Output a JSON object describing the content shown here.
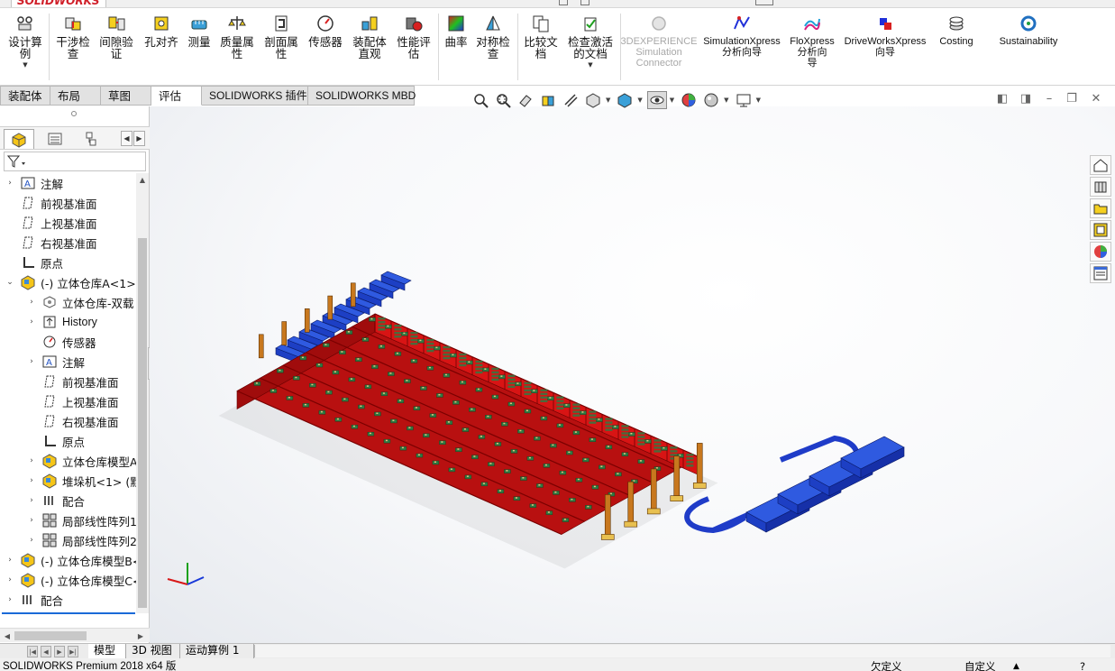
{
  "app": {
    "logo": "SOLIDWORKS"
  },
  "ribbon": {
    "buttons": [
      {
        "label": "设计算\n例",
        "icon": "design-study-icon",
        "disabled": false
      },
      {
        "label": "干涉检\n查",
        "icon": "interference-detection-icon",
        "disabled": false
      },
      {
        "label": "间隙验\n证",
        "icon": "clearance-verification-icon",
        "disabled": false
      },
      {
        "label": "孔对齐",
        "icon": "hole-alignment-icon",
        "disabled": false
      },
      {
        "label": "测量",
        "icon": "measure-icon",
        "disabled": false
      },
      {
        "label": "质量属\n性",
        "icon": "mass-properties-icon",
        "disabled": false
      },
      {
        "label": "剖面属\n性",
        "icon": "section-properties-icon",
        "disabled": false
      },
      {
        "label": "传感器",
        "icon": "sensor-icon",
        "disabled": false
      },
      {
        "label": "装配体\n直观",
        "icon": "assembly-visualization-icon",
        "disabled": false
      },
      {
        "label": "性能评\n估",
        "icon": "performance-evaluation-icon",
        "disabled": false
      },
      {
        "label": "曲率",
        "icon": "curvature-icon",
        "disabled": false
      },
      {
        "label": "对称检\n查",
        "icon": "symmetry-check-icon",
        "disabled": false
      },
      {
        "label": "比较文\n档",
        "icon": "compare-documents-icon",
        "disabled": false
      },
      {
        "label": "检查激活\n的文档",
        "icon": "check-active-document-icon",
        "disabled": false
      },
      {
        "label": "3DEXPERIENCE\nSimulation\nConnector",
        "icon": "3dexperience-icon",
        "disabled": true
      },
      {
        "label": "SimulationXpress\n分析向导",
        "icon": "simulationxpress-icon",
        "disabled": false
      },
      {
        "label": "FloXpress\n分析向\n导",
        "icon": "floxpress-icon",
        "disabled": false
      },
      {
        "label": "DriveWorksXpress\n向导",
        "icon": "driveworksxpress-icon",
        "disabled": false
      },
      {
        "label": "Costing",
        "icon": "costing-icon",
        "disabled": false
      },
      {
        "label": "Sustainability",
        "icon": "sustainability-icon",
        "disabled": false
      }
    ]
  },
  "tabs": [
    "装配体",
    "布局",
    "草图",
    "评估",
    "SOLIDWORKS 插件",
    "SOLIDWORKS MBD"
  ],
  "active_tab": "评估",
  "tree": [
    {
      "label": "注解",
      "icon": "annotation-icon",
      "expander": "›"
    },
    {
      "label": "前视基准面",
      "icon": "plane-icon",
      "expander": ""
    },
    {
      "label": "上视基准面",
      "icon": "plane-icon",
      "expander": ""
    },
    {
      "label": "右视基准面",
      "icon": "plane-icon",
      "expander": ""
    },
    {
      "label": "原点",
      "icon": "origin-icon",
      "expander": ""
    },
    {
      "label": "(-) 立体仓库A<1>",
      "icon": "assembly-icon",
      "expander": "⌄"
    },
    {
      "label": "立体仓库-双载",
      "icon": "part-icon",
      "expander": "›"
    },
    {
      "label": "History",
      "icon": "history-icon",
      "expander": "›"
    },
    {
      "label": "传感器",
      "icon": "sensor-icon",
      "expander": ""
    },
    {
      "label": "注解",
      "icon": "annotation-icon",
      "expander": "›"
    },
    {
      "label": "前视基准面",
      "icon": "plane-icon",
      "expander": ""
    },
    {
      "label": "上视基准面",
      "icon": "plane-icon",
      "expander": ""
    },
    {
      "label": "右视基准面",
      "icon": "plane-icon",
      "expander": ""
    },
    {
      "label": "原点",
      "icon": "origin-icon",
      "expander": ""
    },
    {
      "label": "立体仓库模型A",
      "icon": "assembly-icon",
      "expander": "›"
    },
    {
      "label": "堆垛机<1> (默",
      "icon": "assembly-icon",
      "expander": "›"
    },
    {
      "label": "配合",
      "icon": "mates-icon",
      "expander": "›"
    },
    {
      "label": "局部线性阵列1",
      "icon": "pattern-icon",
      "expander": "›"
    },
    {
      "label": "局部线性阵列2",
      "icon": "pattern-icon",
      "expander": "›"
    },
    {
      "label": "(-) 立体仓库模型B<",
      "icon": "assembly-icon",
      "expander": "›"
    },
    {
      "label": "(-) 立体仓库模型C<",
      "icon": "assembly-icon",
      "expander": "›"
    },
    {
      "label": "配合",
      "icon": "mates-icon",
      "expander": "›"
    }
  ],
  "bottom_tabs": [
    "模型",
    "3D 视图",
    "运动算例 1"
  ],
  "active_bottom_tab": "模型",
  "status": {
    "product": "SOLIDWORKS Premium 2018 x64 版",
    "state": "欠定义",
    "custom": "自定义"
  },
  "colors": {
    "rack_red": "#d81414",
    "goods_green": "#2f7a43",
    "conveyor_blue": "#1f3cc8",
    "stacker_orange": "#c8781e"
  }
}
